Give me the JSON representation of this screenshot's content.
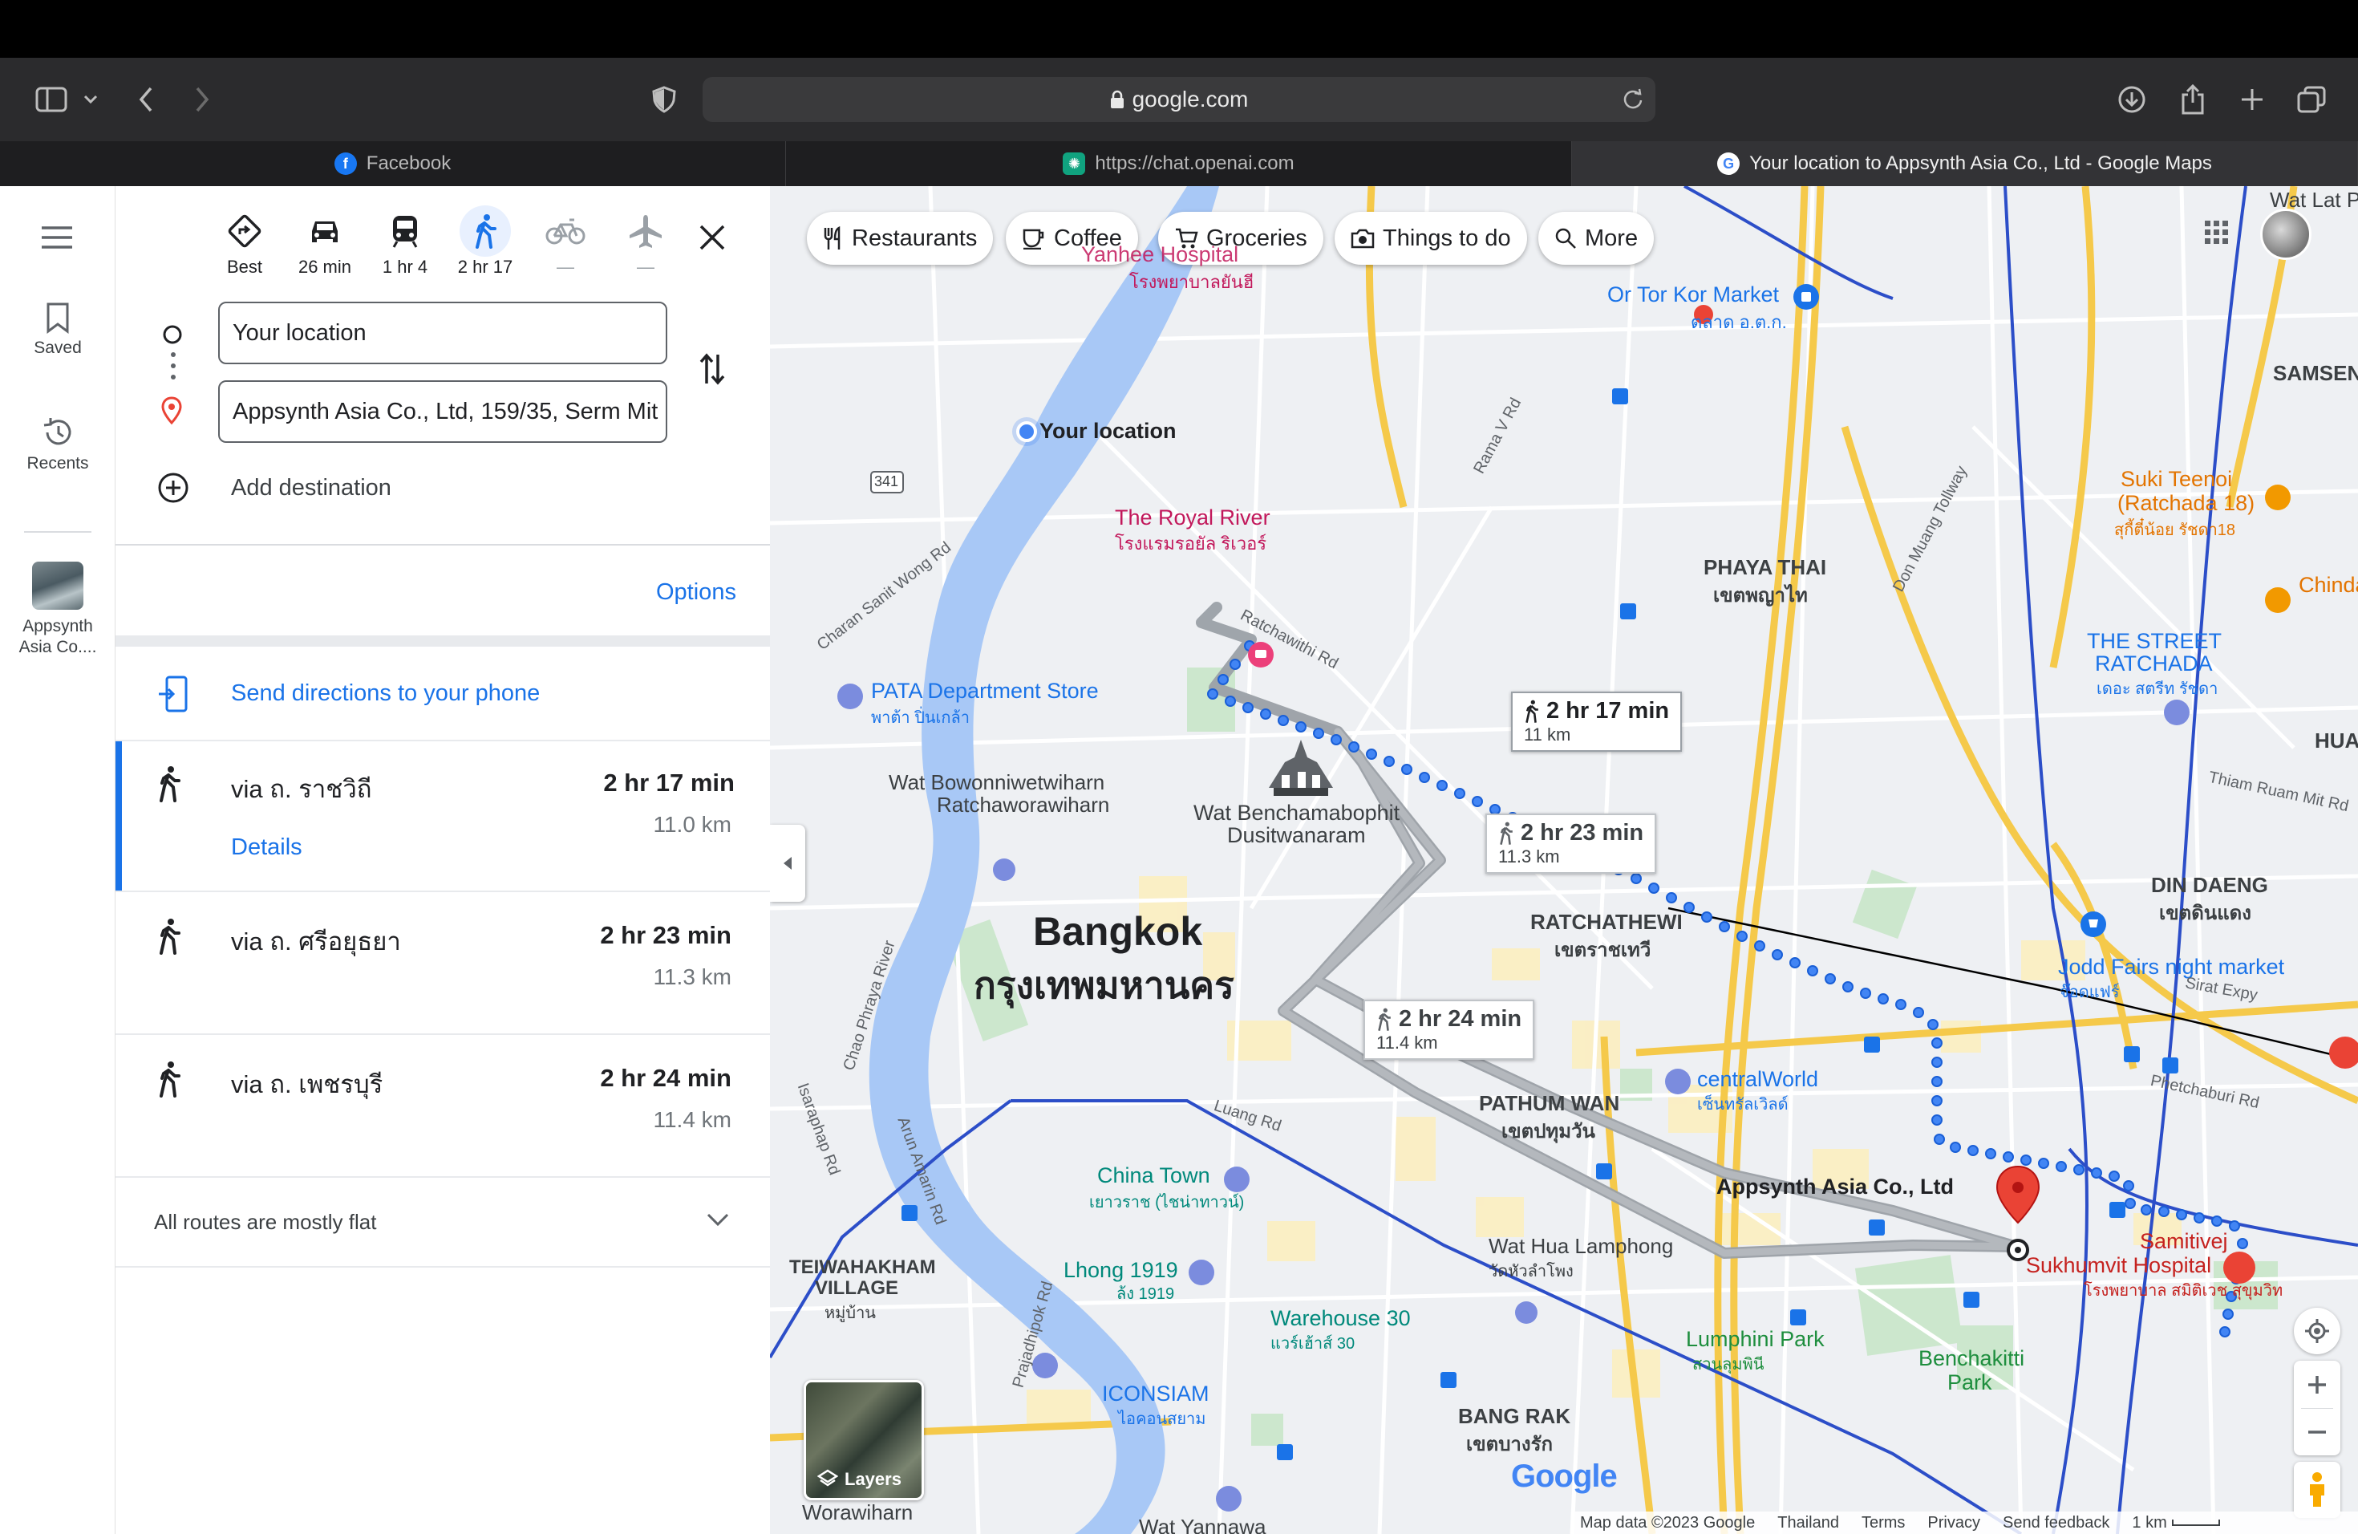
{
  "browser": {
    "url": "google.com",
    "tabs": [
      {
        "title": "Facebook"
      },
      {
        "title": "https://chat.openai.com"
      },
      {
        "title": "Your location to Appsynth Asia Co., Ltd - Google Maps"
      }
    ]
  },
  "rail": {
    "saved": "Saved",
    "recents": "Recents",
    "recent_place": "Appsynth Asia Co...."
  },
  "travel_modes": [
    {
      "icon": "best-route-icon",
      "label": "Best"
    },
    {
      "icon": "car-icon",
      "label": "26 min"
    },
    {
      "icon": "transit-icon",
      "label": "1 hr 4"
    },
    {
      "icon": "walk-icon",
      "label": "2 hr 17"
    },
    {
      "icon": "bike-icon",
      "label": "—"
    },
    {
      "icon": "flight-icon",
      "label": "—"
    }
  ],
  "directions": {
    "origin": "Your location",
    "destination": "Appsynth Asia Co., Ltd, 159/35, Serm Mit",
    "add_destination": "Add destination",
    "options": "Options",
    "send_to_phone": "Send directions to your phone",
    "routes": [
      {
        "via": "via ถ. ราชวิถี",
        "time": "2 hr 17 min",
        "distance": "11.0 km",
        "details": "Details"
      },
      {
        "via": "via ถ. ศรีอยุธยา",
        "time": "2 hr 23 min",
        "distance": "11.3 km"
      },
      {
        "via": "via ถ. เพชรบุรี",
        "time": "2 hr 24 min",
        "distance": "11.4 km"
      }
    ],
    "elevation_note": "All routes are mostly flat"
  },
  "map": {
    "chips": [
      "Restaurants",
      "Coffee",
      "Groceries",
      "Things to do",
      "More"
    ],
    "route_bubbles": [
      {
        "time": "2 hr 17 min",
        "distance": "11 km"
      },
      {
        "time": "2 hr 23 min",
        "distance": "11.3 km"
      },
      {
        "time": "2 hr 24 min",
        "distance": "11.4 km"
      }
    ],
    "labels": {
      "your_location": "Your location",
      "destination": "Appsynth Asia Co., Ltd",
      "city": "Bangkok",
      "city_th": "กรุงเทพมหานคร",
      "royal_river": "The Royal River",
      "royal_river_th": "โรงแรมรอยัล ริเวอร์",
      "yanhee": "Yanhee Hospital",
      "yanhee_th": "โรงพยาบาลยันฮี",
      "or_tor_kor": "Or Tor Kor Market",
      "or_tor_kor_th": "ตลาด อ.ต.ก.",
      "samsen": "SAMSEN",
      "phaya_thai": "PHAYA THAI",
      "phaya_thai_th": "เขตพญาไท",
      "suki": "Suki Teenoi",
      "suki2": "(Ratchada 18)",
      "suki_th": "สุกี้ตี๋น้อย รัชดา18",
      "street": "THE STREET",
      "street2": "RATCHADA",
      "street_th": "เดอะ สตรีท รัชดา",
      "pata": "PATA Department Store",
      "pata_th": "พาต้า ปิ่นเกล้า",
      "wat_bowon": "Wat Bowonniwetwiharn",
      "wat_bowon2": "Ratchaworawiharn",
      "wat_bench": "Wat Benchamabophit",
      "wat_bench2": "Dusitwanaram",
      "din_daeng": "DIN DAENG",
      "din_daeng_th": "เขตดินแดง",
      "ratchathewi": "RATCHATHEWI",
      "ratchathewi_th": "เขตราชเทวี",
      "jodd": "Jodd Fairs night market",
      "jodd_th": "จ๊อดแฟร์",
      "pathum": "PATHUM WAN",
      "pathum_th": "เขตปทุมวัน",
      "central": "centralWorld",
      "central_th": "เซ็นทรัลเวิลด์",
      "chinatown": "China Town",
      "chinatown_th": "เยาวราช (ไชน่าทาวน์)",
      "lhong": "Lhong 1919",
      "lhong_th": "ล้ง 1919",
      "hualamphong": "Wat Hua Lamphong",
      "hualamphong_th": "วัดหัวลำโพง",
      "warehouse": "Warehouse 30",
      "warehouse_th": "แวร์เฮ้าส์ 30",
      "lumphini": "Lumphini Park",
      "lumphini_th": "สวนลุมพินี",
      "benchakitti": "Benchakitti",
      "benchakitti2": "Park",
      "samitivej": "Samitivej",
      "samitivej2": "Sukhumvit Hospital",
      "samitivej_th": "โรงพยาบาล สมิติเวช สุขุมวิท",
      "iconsiam": "ICONSIAM",
      "iconsiam_th": "ไอคอนสยาม",
      "bang_rak": "BANG RAK",
      "bang_rak_th": "เขตบางรัก",
      "teiwa": "TEIWAHAKHAM",
      "teiwa2": "VILLAGE",
      "teiwa_th": "หมู่บ้าน",
      "worawiharn": "Worawiharn",
      "wat_yannawa": "Wat Yannawa",
      "chinda": "Chinda",
      "hua": "HUA",
      "wat_lat": "Wat Lat P",
      "road_341": "341",
      "road_rama5": "Rama V Rd",
      "road_charan": "Charan Sanit Wong Rd",
      "road_ratchawithi": "Ratchawithi Rd",
      "road_don": "Don Muang Tollway",
      "road_thiam": "Thiam Ruam Mit Rd",
      "road_sirat": "Sirat Expy",
      "road_phet": "Phetchaburi Rd",
      "road_luang": "Luang Rd",
      "road_chao": "Chao Phraya River",
      "road_arun": "Arun Amarin Rd",
      "road_isara": "Isaraphap Rd",
      "road_prajadhipok": "Prajadhipok Rd",
      "google": "Google",
      "layers": "Layers"
    },
    "footer": [
      "Map data ©2023 Google",
      "Thailand",
      "Terms",
      "Privacy",
      "Send feedback",
      "1 km"
    ]
  },
  "colors": {
    "accent": "#1a73e8",
    "walk_route": "#4285f4",
    "alt_route": "#a7a9ad"
  }
}
